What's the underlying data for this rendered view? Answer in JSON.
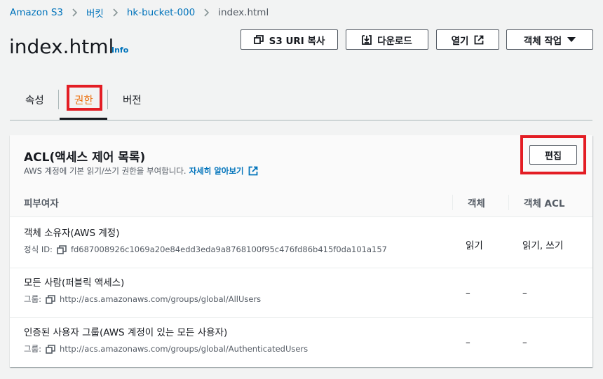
{
  "breadcrumb": {
    "items": [
      "Amazon S3",
      "버킷",
      "hk-bucket-000",
      "index.html"
    ]
  },
  "header": {
    "title": "index.html",
    "info_label": "Info",
    "buttons": {
      "copy_uri": "S3 URI 복사",
      "download": "다운로드",
      "open": "열기",
      "object_actions": "객체 작업"
    }
  },
  "tabs": [
    "속성",
    "권한",
    "버전"
  ],
  "acl": {
    "title": "ACL(액세스 제어 목록)",
    "description": "AWS 계정에 기본 읽기/쓰기 권한을 부여합니다.",
    "learn_more": "자세히 알아보기",
    "edit_label": "편집",
    "columns": [
      "피부여자",
      "객체",
      "객체 ACL"
    ],
    "rows": [
      {
        "grantee": "객체 소유자(AWS 계정)",
        "id_label": "정식 ID:",
        "id_value": "fd687008926c1069a20e84edd3eda9a8768100f95c476fd86b415f0da101a157",
        "object": "읽기",
        "object_acl": "읽기, 쓰기"
      },
      {
        "grantee": "모든 사람(퍼블릭 액세스)",
        "id_label": "그룹:",
        "id_value": "http://acs.amazonaws.com/groups/global/AllUsers",
        "object": "–",
        "object_acl": "–"
      },
      {
        "grantee": "인증된 사용자 그룹(AWS 계정이 있는 모든 사용자)",
        "id_label": "그룹:",
        "id_value": "http://acs.amazonaws.com/groups/global/AuthenticatedUsers",
        "object": "–",
        "object_acl": "–"
      }
    ]
  },
  "colors": {
    "link": "#0073bb",
    "active_tab": "#ec7211",
    "highlight": "#e31d24"
  }
}
